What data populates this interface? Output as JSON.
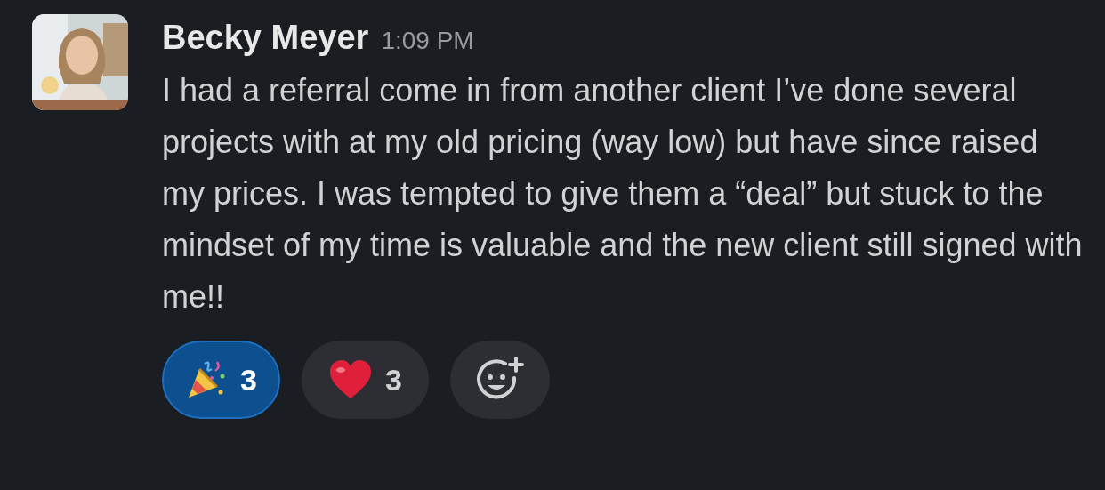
{
  "message": {
    "author": "Becky Meyer",
    "time": "1:09 PM",
    "text": "I had a referral come in from another client I’ve done several projects with at my old pricing (way low) but have since raised my prices. I was tempted to give them a “deal” but stuck to the mindset of my time is valuable and the new client still signed with me!!"
  },
  "reactions": [
    {
      "kind": "party",
      "count": "3",
      "selected": true
    },
    {
      "kind": "heart",
      "count": "3",
      "selected": false
    }
  ]
}
